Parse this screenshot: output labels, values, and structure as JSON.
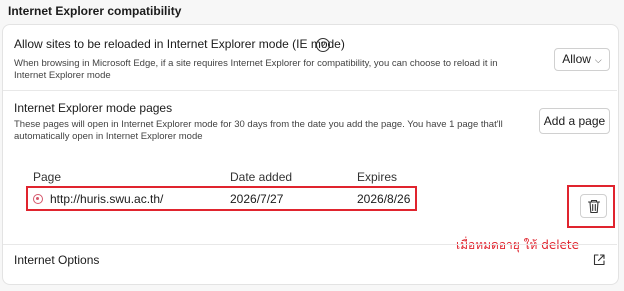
{
  "section_title": "Internet Explorer compatibility",
  "ie_reload": {
    "title": "Allow sites to be reloaded in Internet Explorer mode (IE mode)",
    "help_icon": "question-circle-icon",
    "help_glyph": "?",
    "description": "When browsing in Microsoft Edge, if a site requires Internet Explorer for compatibility, you can choose to reload it in Internet Explorer mode",
    "dropdown_value": "Allow",
    "dropdown_chevron": "⌵"
  },
  "ie_pages": {
    "title": "Internet Explorer mode pages",
    "description": "These pages will open in Internet Explorer mode for 30 days from the date you add the page. You have 1 page that'll automatically open in Internet Explorer mode",
    "add_button": "Add a page",
    "columns": {
      "page": "Page",
      "date_added": "Date added",
      "expires": "Expires"
    },
    "rows": [
      {
        "icon": "site-globe-icon",
        "page": "http://huris.swu.ac.th/",
        "date_added": "2026/7/27",
        "expires": "2026/8/26"
      }
    ],
    "delete_icon": "trash-icon"
  },
  "annotation": {
    "text": "เมื่อหมดอายุ ให้ delete",
    "color": "#e0242e"
  },
  "internet_options": {
    "label": "Internet Options",
    "icon": "external-link-icon"
  }
}
